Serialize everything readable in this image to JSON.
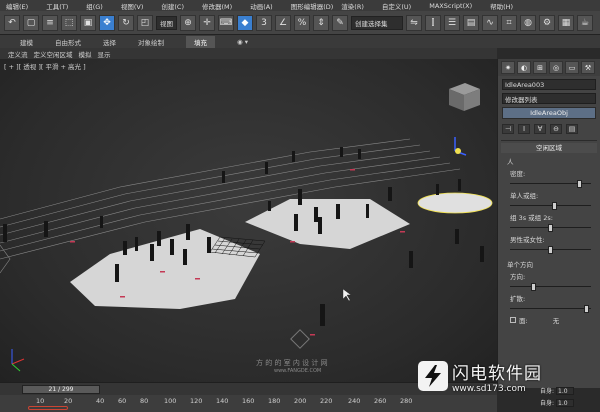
{
  "menu": [
    "编辑(E)",
    "工具(T)",
    "组(G)",
    "视图(V)",
    "创建(C)",
    "修改器(M)",
    "动画(A)",
    "图形编辑器(D)",
    "渲染(R)",
    "自定义(U)",
    "MAXScript(X)",
    "帮助(H)"
  ],
  "toolbar": {
    "view_select": "视图",
    "selection_set": "创建选择集",
    "snap_label": "3",
    "angle_snap": "%"
  },
  "ribbon": {
    "tabs": [
      "建模",
      "自由形式",
      "选择",
      "对象绘制",
      "填充"
    ],
    "active": "填充"
  },
  "subtabs": [
    "定义流",
    "定义空闲区域",
    "模拟",
    "显示"
  ],
  "viewport": {
    "label": "[ + ][ 透视 ][ 平滑 + 高光 ]",
    "watermark_cn": "方 的 的 室 内 设 计 网",
    "watermark_en": "www.FANGDE.COM"
  },
  "panel": {
    "object_name": "IdleArea003",
    "modifier_list": "修改器列表",
    "stack_item": "IdleAreaObj",
    "rollout_title": "空闲区域",
    "group_people": "人",
    "density_label": "密度:",
    "density_value": 0.87,
    "single_group_label": "单人或组:",
    "single_group_value": 0.55,
    "group_label": "组 3s 或组 2s:",
    "group_value": 0.5,
    "male_female_label": "男性或女性:",
    "male_female_value": 0.5,
    "group_direction": "单个方向",
    "direction_label": "方向:",
    "direction_value": 0.3,
    "spread_label": "扩散:",
    "spread_value": 0.95,
    "face_label": "面:",
    "face_right": "无",
    "frame_label": "自身:",
    "frame_value": "1.0",
    "frame_label2": "自身:",
    "frame_value2": "1.0"
  },
  "timeline": {
    "position": "21 / 299",
    "ticks": [
      "10",
      "20",
      "40",
      "60",
      "80",
      "100",
      "120",
      "140",
      "160",
      "180",
      "200",
      "220",
      "240",
      "260",
      "280"
    ]
  },
  "brand": {
    "name": "闪电软件园",
    "url": "www.sd173.com"
  },
  "colors": {
    "accent_blue": "#3a7fd0",
    "floor": "#d6d6d6",
    "grid": "#8a8a8a"
  }
}
